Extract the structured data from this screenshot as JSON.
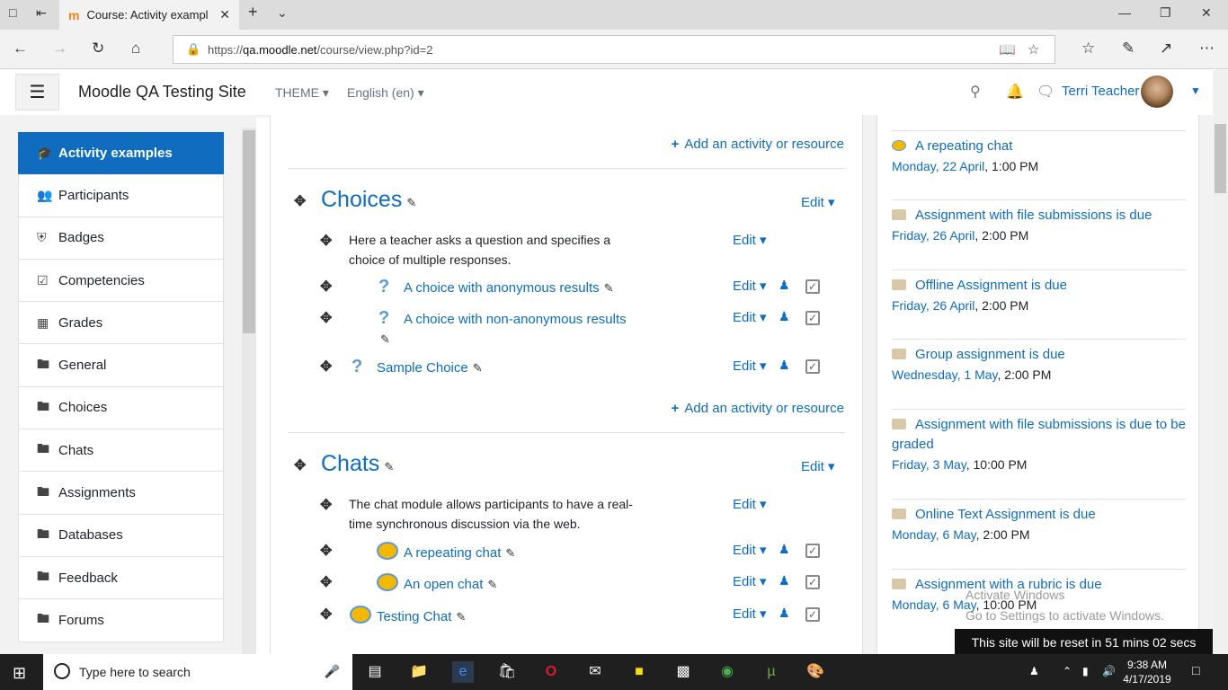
{
  "browser": {
    "tab_title": "Course: Activity exampl",
    "url_prefix": "https://",
    "url_host": "qa.moodle.net",
    "url_path": "/course/view.php?id=2"
  },
  "navbar": {
    "site_name": "Moodle QA Testing Site",
    "theme_label": "THEME",
    "language_label": "English (en)",
    "user_name": "Terri Teacher"
  },
  "drawer": {
    "items": [
      {
        "label": "Activity examples",
        "icon": "graduation-cap-icon",
        "active": true
      },
      {
        "label": "Participants",
        "icon": "users-icon"
      },
      {
        "label": "Badges",
        "icon": "shield-icon"
      },
      {
        "label": "Competencies",
        "icon": "check-square-icon"
      },
      {
        "label": "Grades",
        "icon": "table-icon"
      },
      {
        "label": "General",
        "icon": "folder-icon"
      },
      {
        "label": "Choices",
        "icon": "folder-icon"
      },
      {
        "label": "Chats",
        "icon": "folder-icon"
      },
      {
        "label": "Assignments",
        "icon": "folder-icon"
      },
      {
        "label": "Databases",
        "icon": "folder-icon"
      },
      {
        "label": "Feedback",
        "icon": "folder-icon"
      },
      {
        "label": "Forums",
        "icon": "folder-icon"
      }
    ]
  },
  "main": {
    "add_activity_label": "Add an activity or resource",
    "edit_label": "Edit",
    "sections": [
      {
        "title": "Choices",
        "description": "Here a teacher asks a question and specifies a choice of multiple responses.",
        "activities": [
          {
            "name": "A choice with anonymous results",
            "icon": "question-icon"
          },
          {
            "name": "A choice with non-anonymous results",
            "icon": "question-icon"
          },
          {
            "name": "Sample Choice",
            "icon": "question-icon"
          }
        ]
      },
      {
        "title": "Chats",
        "description": "The chat module allows participants to have a real-time synchronous discussion via the web.",
        "activities": [
          {
            "name": "A repeating chat",
            "icon": "chat-icon"
          },
          {
            "name": "An open chat",
            "icon": "chat-icon"
          },
          {
            "name": "Testing Chat",
            "icon": "chat-icon"
          }
        ]
      }
    ]
  },
  "events": [
    {
      "name": "A repeating chat",
      "date_link": "Monday, 22 April",
      "time": ", 1:00 PM",
      "icon": "chat-icon"
    },
    {
      "name": "Assignment with file submissions is due",
      "date_link": "Friday, 26 April",
      "time": ", 2:00 PM",
      "icon": "assignment-icon"
    },
    {
      "name": "Offline Assignment is due",
      "date_link": "Friday, 26 April",
      "time": ", 2:00 PM",
      "icon": "assignment-icon"
    },
    {
      "name": "Group assignment is due",
      "date_link": "Wednesday, 1 May",
      "time": ", 2:00 PM",
      "icon": "assignment-icon"
    },
    {
      "name": "Assignment with file submissions is due to be graded",
      "date_link": "Friday, 3 May",
      "time": ", 10:00 PM",
      "icon": "assignment-icon"
    },
    {
      "name": "Online Text Assignment is due",
      "date_link": "Monday, 6 May",
      "time": ", 2:00 PM",
      "icon": "assignment-icon"
    },
    {
      "name": "Assignment with a rubric is due",
      "date_link": "Monday, 6 May",
      "time": ", 10:00 PM",
      "icon": "assignment-icon"
    }
  ],
  "watermark": {
    "line1": "Activate Windows",
    "line2": "Go to Settings to activate Windows."
  },
  "reset_notice": "This site will be reset in 51 mins 02 secs",
  "taskbar": {
    "search_placeholder": "Type here to search",
    "time": "9:38 AM",
    "date": "4/17/2019"
  }
}
